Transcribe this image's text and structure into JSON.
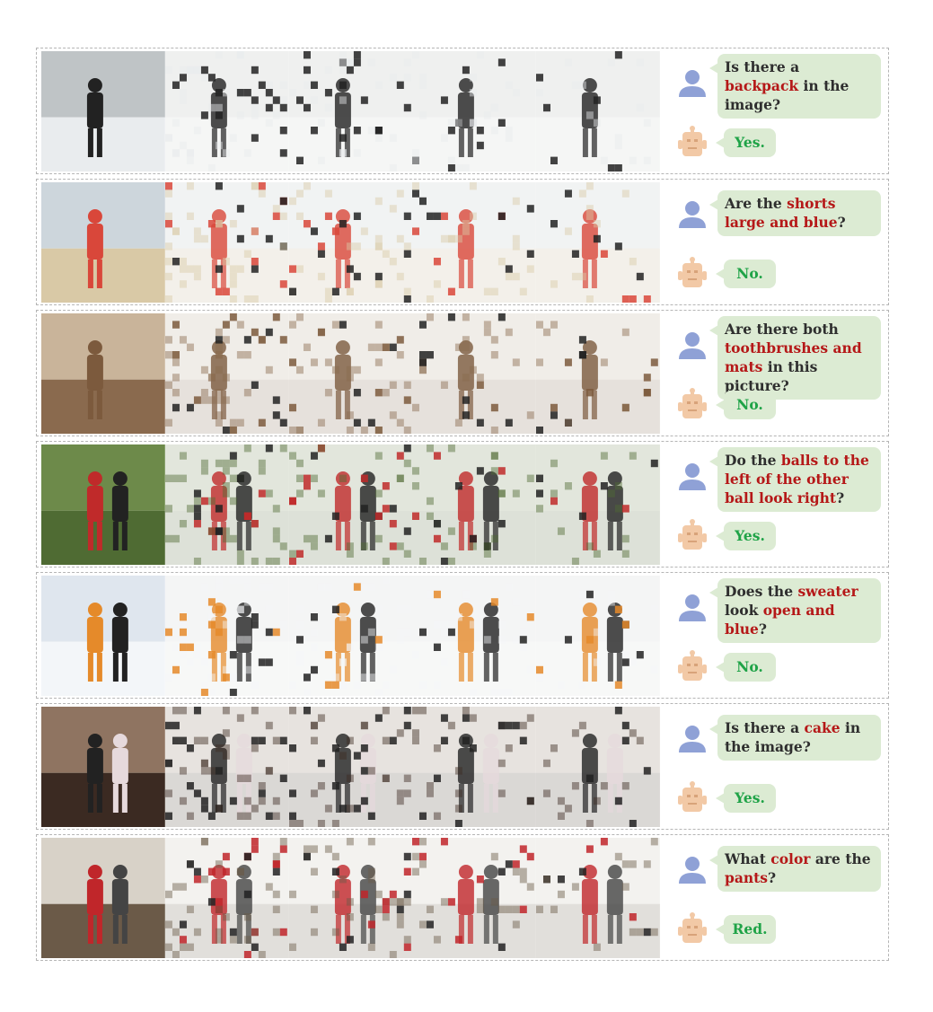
{
  "colors": {
    "highlight": "#b51818",
    "answer": "#1fa347",
    "bubble": "#dcebd3",
    "user_avatar": "#8fa1d6",
    "robot_avatar": "#f2c9a6"
  },
  "icons": {
    "user": "user-icon",
    "assistant": "robot-icon"
  },
  "rows": [
    {
      "scene": "snow-skier",
      "question": [
        {
          "t": "Is there a "
        },
        {
          "t": "backpack",
          "hl": true
        },
        {
          "t": " in the image?"
        }
      ],
      "answer": "Yes."
    },
    {
      "scene": "beach-surfboard",
      "question": [
        {
          "t": "Are the "
        },
        {
          "t": "shorts large and blue",
          "hl": true
        },
        {
          "t": "?"
        }
      ],
      "answer": "No."
    },
    {
      "scene": "bathroom-girl",
      "question": [
        {
          "t": "Are there both "
        },
        {
          "t": "toothbrushes and mats",
          "hl": true
        },
        {
          "t": " in this picture?"
        }
      ],
      "answer": "No."
    },
    {
      "scene": "grass-kids",
      "question": [
        {
          "t": "Do the "
        },
        {
          "t": "balls to the left of the other ball look right",
          "hl": true
        },
        {
          "t": "?"
        }
      ],
      "answer": "Yes."
    },
    {
      "scene": "snow-couple",
      "question": [
        {
          "t": "Does the "
        },
        {
          "t": "sweater",
          "hl": true
        },
        {
          "t": " look "
        },
        {
          "t": "open and blue",
          "hl": true
        },
        {
          "t": "?"
        }
      ],
      "answer": "No."
    },
    {
      "scene": "wedding-cake",
      "question": [
        {
          "t": "Is there a "
        },
        {
          "t": "cake",
          "hl": true
        },
        {
          "t": " in the image?"
        }
      ],
      "answer": "Yes."
    },
    {
      "scene": "bathroom-red-pants",
      "question": [
        {
          "t": "What "
        },
        {
          "t": "color",
          "hl": true
        },
        {
          "t": " are the "
        },
        {
          "t": "pants",
          "hl": true
        },
        {
          "t": "?"
        }
      ],
      "answer": "Red."
    }
  ]
}
